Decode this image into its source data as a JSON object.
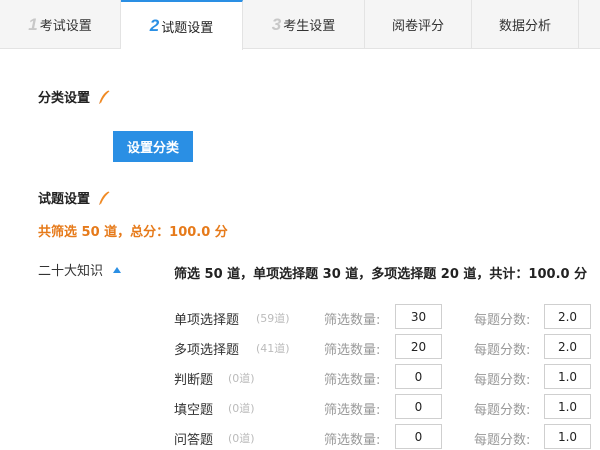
{
  "tabs": [
    {
      "num": "1",
      "label": "考试设置"
    },
    {
      "num": "2",
      "label": "试题设置"
    },
    {
      "num": "3",
      "label": "考生设置"
    },
    {
      "num": "",
      "label": "阅卷评分"
    },
    {
      "num": "",
      "label": "数据分析"
    }
  ],
  "category_section": {
    "title": "分类设置",
    "button_label": "设置分类"
  },
  "question_section": {
    "title": "试题设置",
    "summary": "共筛选 50 道，总分：100.0 分"
  },
  "category": {
    "name": "二十大知识",
    "filter_summary": "筛选 50 道，单项选择题 30 道，多项选择题 20 道，共计：100.0 分"
  },
  "labels": {
    "filter_count": "筛选数量:",
    "per_score": "每题分数:"
  },
  "question_types": [
    {
      "name": "单项选择题",
      "available": "(59道)",
      "filter": "30",
      "score": "2.0"
    },
    {
      "name": "多项选择题",
      "available": "(41道)",
      "filter": "20",
      "score": "2.0"
    },
    {
      "name": "判断题",
      "available": "(0道)",
      "filter": "0",
      "score": "1.0"
    },
    {
      "name": "填空题",
      "available": "(0道)",
      "filter": "0",
      "score": "1.0"
    },
    {
      "name": "问答题",
      "available": "(0道)",
      "filter": "0",
      "score": "1.0"
    }
  ],
  "colors": {
    "accent": "#2a8fe4",
    "summary": "#e67a1a",
    "pen": "#f08a24"
  }
}
